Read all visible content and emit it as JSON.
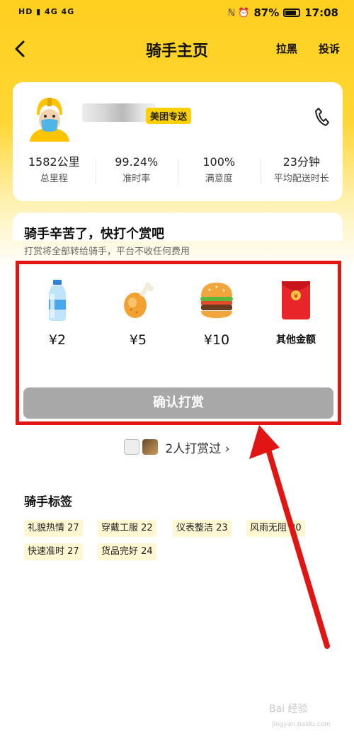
{
  "status_bar": {
    "left": "HD ▮ 4G 4G",
    "battery": "87%",
    "time": "17:08"
  },
  "nav": {
    "title": "骑手主页",
    "block_label": "拉黑",
    "report_label": "投诉"
  },
  "rider": {
    "badge": "美团专送",
    "stats": [
      {
        "value": "1582公里",
        "label": "总里程"
      },
      {
        "value": "99.24%",
        "label": "准时率"
      },
      {
        "value": "100%",
        "label": "满意度"
      },
      {
        "value": "23分钟",
        "label": "平均配送时长"
      }
    ]
  },
  "tip": {
    "title": "骑手辛苦了，快打个赏吧",
    "subtitle": "打赏将全部转给骑手，平台不收任何费用",
    "options": [
      {
        "icon": "water-bottle-icon",
        "amount": "¥2"
      },
      {
        "icon": "chicken-leg-icon",
        "amount": "¥5"
      },
      {
        "icon": "burger-icon",
        "amount": "¥10"
      },
      {
        "icon": "red-envelope-icon",
        "amount": "其他金额"
      }
    ],
    "confirm_label": "确认打赏",
    "tippers_text": "2人打赏过 ›"
  },
  "tags": {
    "title": "骑手标签",
    "items": [
      "礼貌热情 27",
      "穿戴工服 22",
      "仪表整洁 23",
      "风雨无阻 20",
      "快速准时 27",
      "货品完好 24"
    ]
  },
  "watermark": {
    "text": "Bai 经验",
    "sub": "jingyan.baidu.com"
  },
  "colors": {
    "brand_yellow": "#ffd000",
    "highlight_red": "#e21515",
    "button_disabled": "#a8a8a8"
  }
}
